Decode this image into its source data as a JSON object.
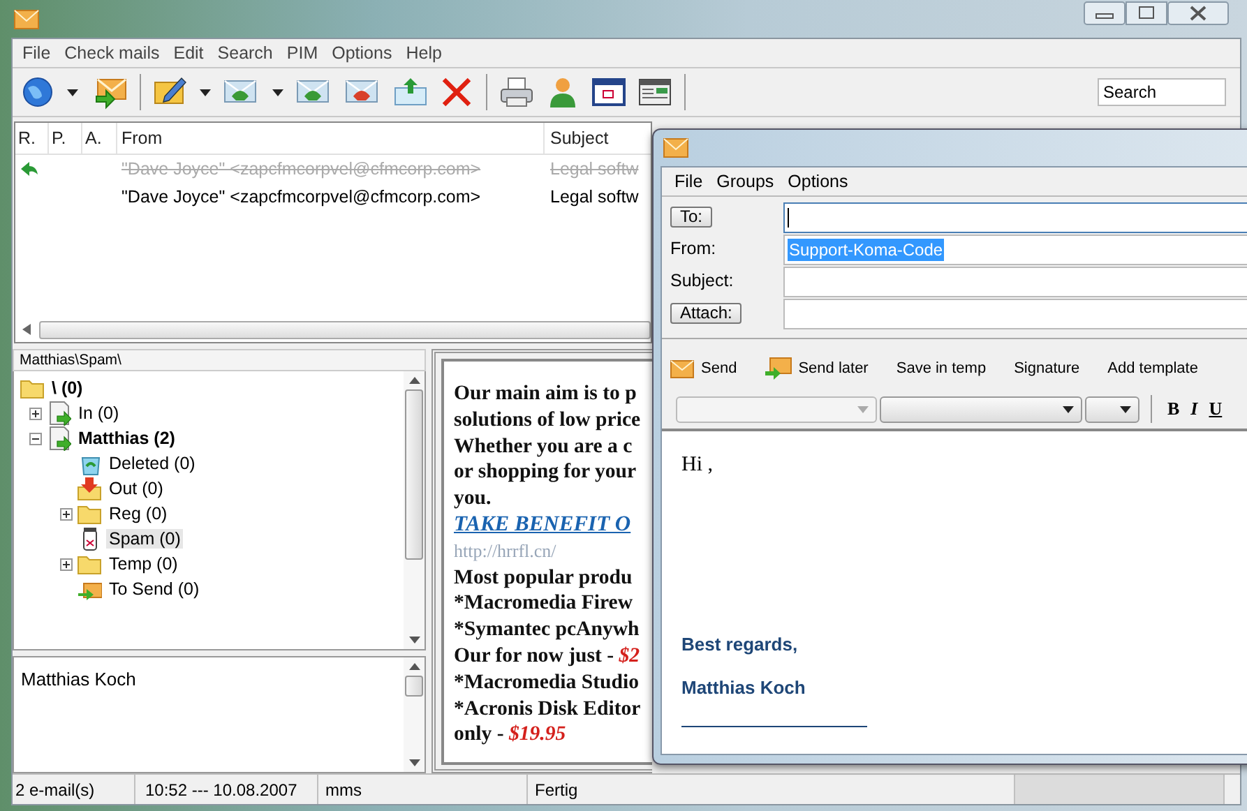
{
  "main_window": {
    "menu": [
      "File",
      "Check mails",
      "Edit",
      "Search",
      "PIM",
      "Options",
      "Help"
    ],
    "search": {
      "value": "Search"
    },
    "message_list": {
      "columns": [
        "R.",
        "P.",
        "A.",
        "From",
        "Subject"
      ],
      "rows": [
        {
          "replied": true,
          "deleted": true,
          "from": "\"Dave Joyce\" <zapcfmcorpvel@cfmcorp.com>",
          "subject": "Legal softw"
        },
        {
          "replied": false,
          "deleted": false,
          "from": "\"Dave Joyce\" <zapcfmcorpvel@cfmcorp.com>",
          "subject": "Legal softw"
        }
      ]
    },
    "folder_path": "Matthias\\Spam\\",
    "folders": [
      {
        "label": "\\ (0)",
        "kind": "folder",
        "unread": true,
        "selected": false,
        "children": [
          {
            "label": "In (0)",
            "kind": "inbox",
            "unread": false,
            "selected": false,
            "expanded": false
          },
          {
            "label": "Matthias (2)",
            "kind": "inbox",
            "unread": true,
            "selected": false,
            "expanded": true,
            "children": [
              {
                "label": "Deleted (0)",
                "kind": "trash",
                "unread": false,
                "selected": false
              },
              {
                "label": "Out (0)",
                "kind": "outbox",
                "unread": false,
                "selected": false
              },
              {
                "label": "Reg (0)",
                "kind": "folder",
                "unread": false,
                "selected": false,
                "expanded": false
              },
              {
                "label": "Spam (0)",
                "kind": "spam",
                "unread": false,
                "selected": true
              },
              {
                "label": "Temp (0)",
                "kind": "folder",
                "unread": false,
                "selected": false,
                "expanded": false
              },
              {
                "label": "To Send (0)",
                "kind": "tosend",
                "unread": false,
                "selected": false
              }
            ]
          }
        ]
      }
    ],
    "contact": "Matthias Koch",
    "message_body": [
      {
        "kind": "text",
        "text": "Our main aim is to p"
      },
      {
        "kind": "text",
        "text": "solutions of low price"
      },
      {
        "kind": "text",
        "text": "Whether you are a c"
      },
      {
        "kind": "text",
        "text": "or shopping for your"
      },
      {
        "kind": "text",
        "text": "you."
      },
      {
        "kind": "link",
        "text": "TAKE BENEFIT O"
      },
      {
        "kind": "url",
        "text": "http://hrrfl.cn/"
      },
      {
        "kind": "text",
        "text": "Most popular produ"
      },
      {
        "kind": "text",
        "text": "*Macromedia Firew"
      },
      {
        "kind": "text",
        "text": "*Symantec pcAnywh"
      },
      {
        "kind": "price",
        "text": "Our for now just - ",
        "price": "$2"
      },
      {
        "kind": "text",
        "text": "*Macromedia Studio"
      },
      {
        "kind": "text",
        "text": "*Acronis Disk Editor"
      },
      {
        "kind": "price",
        "text": "only - ",
        "price": "$19.95"
      }
    ],
    "status_bar": [
      "2 e-mail(s)",
      "10:52 --- 10.08.2007",
      "mms",
      "Fertig"
    ]
  },
  "compose_window": {
    "menu": [
      "File",
      "Groups",
      "Options"
    ],
    "fields": [
      {
        "kind": "button",
        "label": "To:",
        "focused": true
      },
      {
        "kind": "label",
        "label": "From:",
        "value": "Support-Koma-Code",
        "focused": false,
        "text_selected": true
      },
      {
        "kind": "label",
        "label": "Subject:",
        "focused": false
      },
      {
        "kind": "button",
        "label": "Attach:",
        "focused": false
      }
    ],
    "toolbar": [
      {
        "kind": "send",
        "label": "Send"
      },
      {
        "kind": "sendlater",
        "label": "Send later"
      },
      {
        "kind": "text",
        "label": "Save in temp"
      },
      {
        "kind": "text",
        "label": "Signature"
      },
      {
        "kind": "text",
        "label": "Add template"
      }
    ],
    "format_buttons": [
      {
        "kind": "bold",
        "label": "B"
      },
      {
        "kind": "italic",
        "label": "I"
      },
      {
        "kind": "underline",
        "label": "U"
      }
    ],
    "editor": {
      "greeting": "Hi ,",
      "signature": [
        "Best regards,",
        "Matthias Koch"
      ]
    }
  }
}
